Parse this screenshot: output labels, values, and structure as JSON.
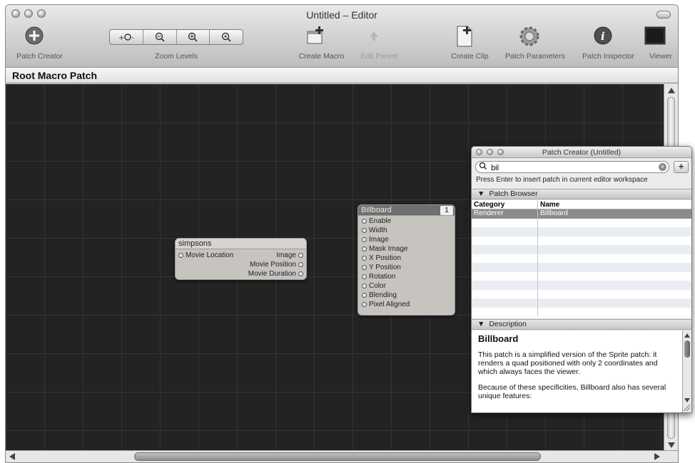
{
  "window": {
    "title": "Untitled – Editor"
  },
  "toolbar": {
    "patch_creator": "Patch Creator",
    "zoom_levels": "Zoom Levels",
    "create_macro": "Create Macro",
    "edit_parent": "Edit Parent",
    "create_clip": "Create Clip",
    "patch_parameters": "Patch Parameters",
    "patch_inspector": "Patch Inspector",
    "viewer": "Viewer"
  },
  "path_bar": {
    "title": "Root Macro Patch"
  },
  "patches": {
    "simpsons": {
      "title": "simpsons",
      "input": "Movie Location",
      "outputs": [
        "Image",
        "Movie Position",
        "Movie Duration"
      ]
    },
    "billboard": {
      "title": "Billboard",
      "layer": "1",
      "inputs": [
        "Enable",
        "Width",
        "Image",
        "Mask Image",
        "X Position",
        "Y Position",
        "Rotation",
        "Color",
        "Blending",
        "Pixel Aligned"
      ]
    }
  },
  "patch_creator": {
    "title": "Patch Creator (Untitled)",
    "search_value": "bil",
    "add_label": "+",
    "hint": "Press Enter to insert patch in current editor workspace",
    "browser_label": "Patch Browser",
    "columns": [
      "Category",
      "Name"
    ],
    "rows": [
      {
        "category": "Renderer",
        "name": "Billboard"
      }
    ],
    "description_label": "Description",
    "description_title": "Billboard",
    "description_p1": "This patch is a simplified version of the Sprite patch: it renders a quad positioned with only 2 coordinates and which always faces the viewer.",
    "description_p2": "Because of these specificities, Billboard also has several unique features:"
  },
  "colors": {
    "canvas": "#232323",
    "selection": "#8b8b8b",
    "patch_body": "#c7c4c0"
  }
}
